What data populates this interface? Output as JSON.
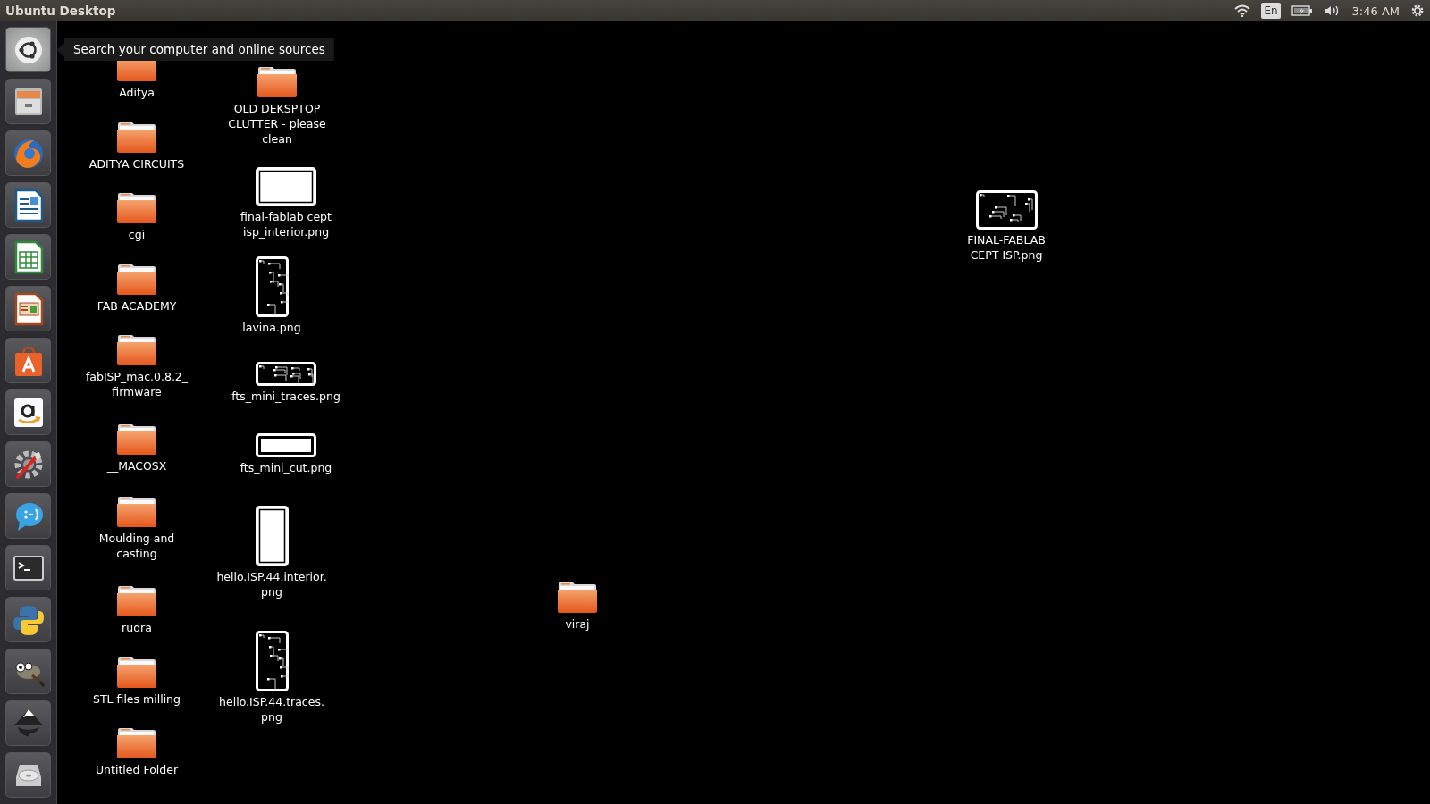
{
  "top_bar": {
    "title": "Ubuntu Desktop",
    "keyboard_layout": "En",
    "clock": "3:46 AM"
  },
  "launcher": {
    "items": [
      {
        "kind": "dash"
      },
      {
        "kind": "files"
      },
      {
        "kind": "browser"
      },
      {
        "kind": "document"
      },
      {
        "kind": "spreadsheet"
      },
      {
        "kind": "presentation"
      },
      {
        "kind": "store"
      },
      {
        "kind": "shop"
      },
      {
        "kind": "settings"
      },
      {
        "kind": "chat"
      },
      {
        "kind": "terminal"
      },
      {
        "kind": "python"
      },
      {
        "kind": "paint"
      },
      {
        "kind": "vector"
      },
      {
        "kind": "disk"
      }
    ]
  },
  "tooltip": "Search your computer and online sources",
  "desktop_items": [
    {
      "kind": "folder",
      "label": "Aditya"
    },
    {
      "kind": "folder",
      "label": "ADITYA CIRCUITS"
    },
    {
      "kind": "folder",
      "label": "cgi"
    },
    {
      "kind": "folder",
      "label": "FAB ACADEMY"
    },
    {
      "kind": "folder",
      "label": "fabISP_mac.0.8.2_firmware"
    },
    {
      "kind": "folder",
      "label": "__MACOSX"
    },
    {
      "kind": "folder",
      "label": "Moulding and casting"
    },
    {
      "kind": "folder",
      "label": "rudra"
    },
    {
      "kind": "folder",
      "label": "STL files milling"
    },
    {
      "kind": "folder",
      "label": "Untitled Folder"
    },
    {
      "kind": "folder",
      "label": "OLD DEKSPTOP CLUTTER - please clean"
    },
    {
      "kind": "image",
      "label": "final-fablab cept isp_interior.png"
    },
    {
      "kind": "image",
      "label": "lavina.png"
    },
    {
      "kind": "image",
      "label": "fts_mini_traces.png"
    },
    {
      "kind": "image",
      "label": "fts_mini_cut.png"
    },
    {
      "kind": "image",
      "label": "hello.ISP.44.interior.png"
    },
    {
      "kind": "image",
      "label": "hello.ISP.44.traces.png"
    },
    {
      "kind": "folder",
      "label": "viraj"
    },
    {
      "kind": "image",
      "label": "FINAL-FABLAB CEPT ISP.png"
    }
  ]
}
